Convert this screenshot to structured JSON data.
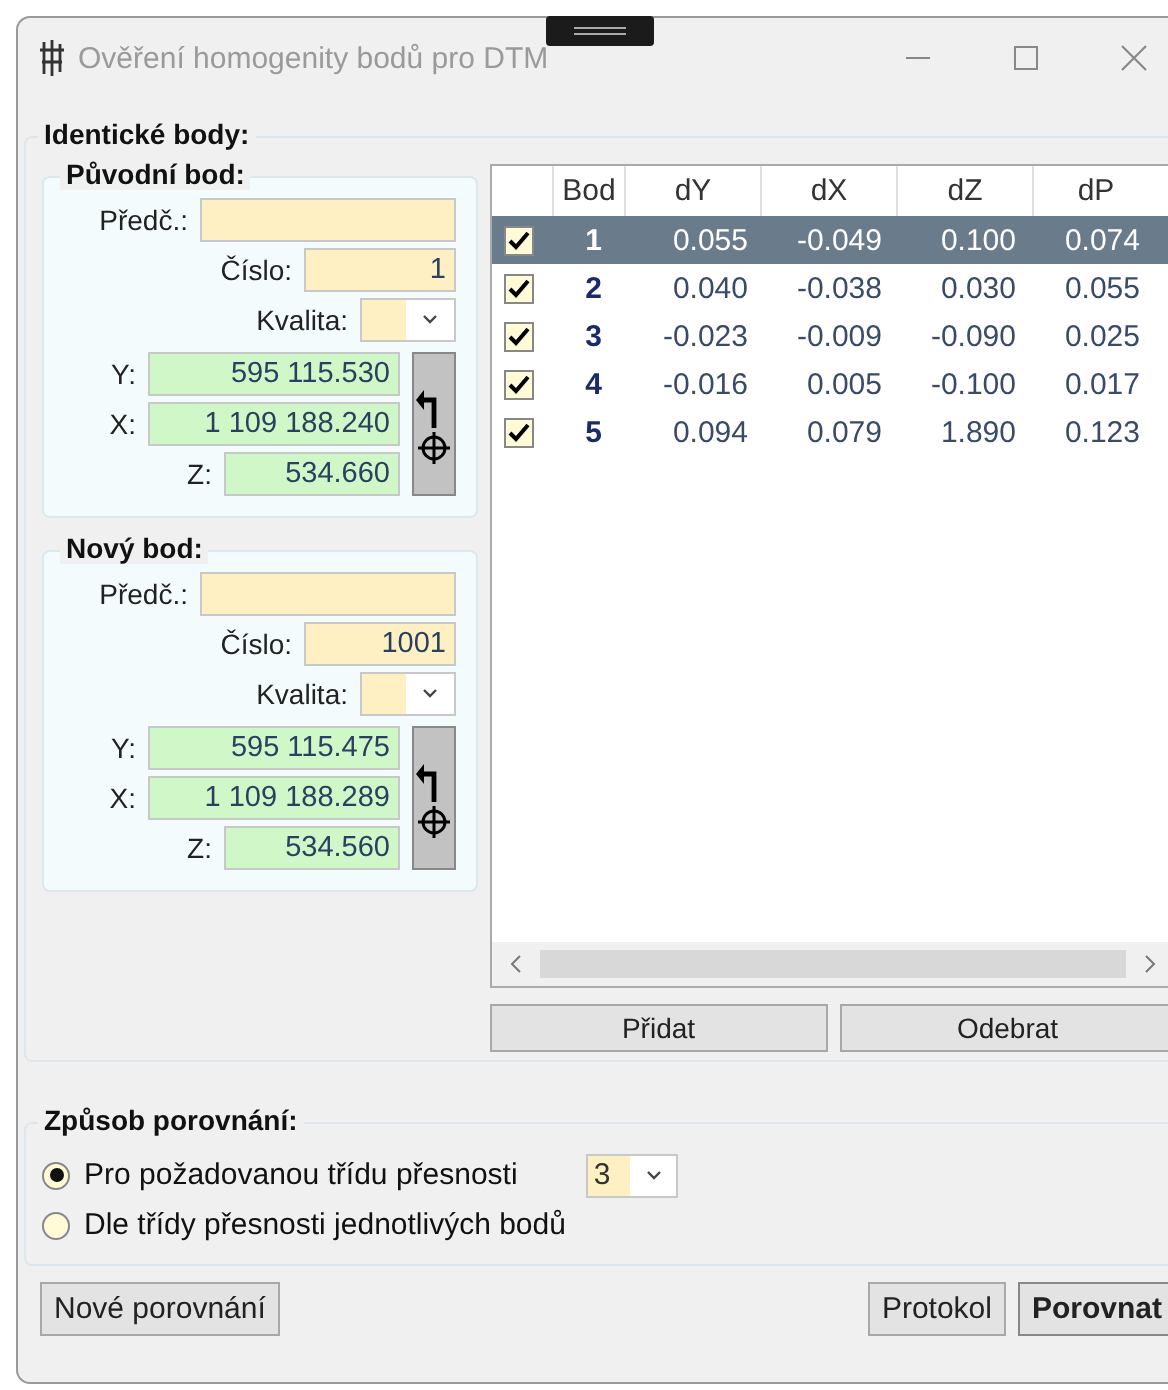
{
  "window": {
    "title": "Ověření homogenity bodů pro DTM"
  },
  "identical_points": {
    "title": "Identické body:",
    "points": [
      {
        "title": "Původní bod:",
        "prefix": {
          "label": "Předč.:"
        },
        "number": {
          "label": "Číslo:",
          "value": "1"
        },
        "quality": {
          "label": "Kvalita:"
        },
        "coords": [
          {
            "label": "Y:",
            "value": "595 115.530"
          },
          {
            "label": "X:",
            "value": "1 109 188.240"
          },
          {
            "label": "Z:",
            "value": "534.660"
          }
        ]
      },
      {
        "title": "Nový bod:",
        "prefix": {
          "label": "Předč.:"
        },
        "number": {
          "label": "Číslo:",
          "value": "1001"
        },
        "quality": {
          "label": "Kvalita:"
        },
        "coords": [
          {
            "label": "Y:",
            "value": "595 115.475"
          },
          {
            "label": "X:",
            "value": "1 109 188.289"
          },
          {
            "label": "Z:",
            "value": "534.560"
          }
        ]
      }
    ],
    "table": {
      "columns": [
        "Bod",
        "dY",
        "dX",
        "dZ",
        "dP"
      ],
      "rows": [
        {
          "checked": true,
          "selected": true,
          "cells": [
            "1",
            "0.055",
            "-0.049",
            "0.100",
            "0.074"
          ]
        },
        {
          "checked": true,
          "selected": false,
          "cells": [
            "2",
            "0.040",
            "-0.038",
            "0.030",
            "0.055"
          ]
        },
        {
          "checked": true,
          "selected": false,
          "cells": [
            "3",
            "-0.023",
            "-0.009",
            "-0.090",
            "0.025"
          ]
        },
        {
          "checked": true,
          "selected": false,
          "cells": [
            "4",
            "-0.016",
            "0.005",
            "-0.100",
            "0.017"
          ]
        },
        {
          "checked": true,
          "selected": false,
          "cells": [
            "5",
            "0.094",
            "0.079",
            "1.890",
            "0.123"
          ]
        }
      ]
    },
    "buttons": [
      "Přidat",
      "Odebrat"
    ]
  },
  "comparison": {
    "title": "Způsob porovnání:",
    "options": [
      {
        "label": "Pro požadovanou třídu přesnosti",
        "selected": true
      },
      {
        "label": "Dle třídy přesnosti jednotlivých bodů",
        "selected": false
      }
    ],
    "class_select": {
      "value": "3"
    }
  },
  "footer": {
    "left_buttons": [
      {
        "label": "Nové porovnání",
        "kind": "normal"
      }
    ],
    "right_buttons": [
      {
        "label": "Protokol",
        "kind": "normal"
      },
      {
        "label": "Porovnat",
        "kind": "default"
      }
    ]
  }
}
